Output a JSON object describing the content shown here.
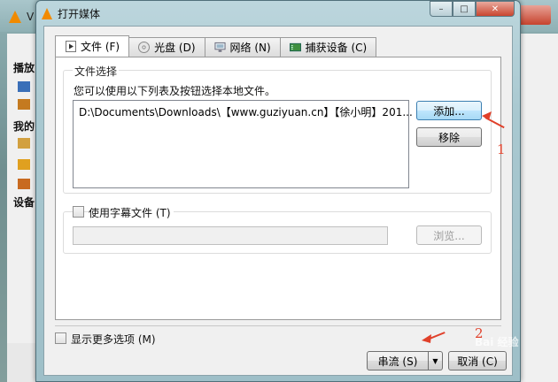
{
  "background_window": {
    "title_fragment": "V",
    "sidebar_fragments": [
      "播放",
      "我的",
      "设备"
    ]
  },
  "dialog": {
    "title": "打开媒体",
    "caption_buttons": {
      "minimize": "–",
      "maximize": "□",
      "close": "✕"
    }
  },
  "tabs": [
    {
      "label": "文件 (F)",
      "icon": "file-play-icon",
      "active": true
    },
    {
      "label": "光盘 (D)",
      "icon": "disc-icon",
      "active": false
    },
    {
      "label": "网络 (N)",
      "icon": "network-icon",
      "active": false
    },
    {
      "label": "捕获设备 (C)",
      "icon": "capture-device-icon",
      "active": false
    }
  ],
  "file_selection": {
    "group_title": "文件选择",
    "hint": "您可以使用以下列表及按钮选择本地文件。",
    "files": [
      "D:\\Documents\\Downloads\\【www.guziyuan.cn】【徐小明】201..."
    ],
    "add_label": "添加...",
    "remove_label": "移除"
  },
  "subtitle": {
    "checkbox_label": "使用字幕文件 (T)",
    "checked": false,
    "path_value": "",
    "browse_label": "浏览..."
  },
  "footer": {
    "show_more_label": "显示更多选项 (M)",
    "stream_label": "串流 (S)",
    "cancel_label": "取消 (C)"
  },
  "annotations": {
    "label_1": "1",
    "label_2": "2"
  },
  "watermark": "Bai 经验",
  "colors": {
    "accent_annotation": "#e0402a",
    "vlc_orange": "#f28a00",
    "dialog_frame": "#a9c8d0"
  }
}
